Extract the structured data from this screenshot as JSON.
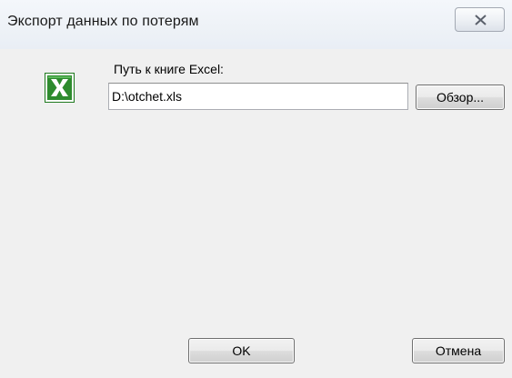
{
  "window": {
    "title": "Экспорт данных по потерям",
    "close_icon": "close-icon"
  },
  "form": {
    "path_label": "Путь к книге Excel:",
    "path_value": "D:\\otchet.xls",
    "browse_label": "Обзор...",
    "file_icon": "excel-icon"
  },
  "footer": {
    "ok_label": "OK",
    "cancel_label": "Отмена"
  },
  "colors": {
    "excel_green": "#1f7a1f",
    "dialog_background": "#f0f0f0"
  }
}
